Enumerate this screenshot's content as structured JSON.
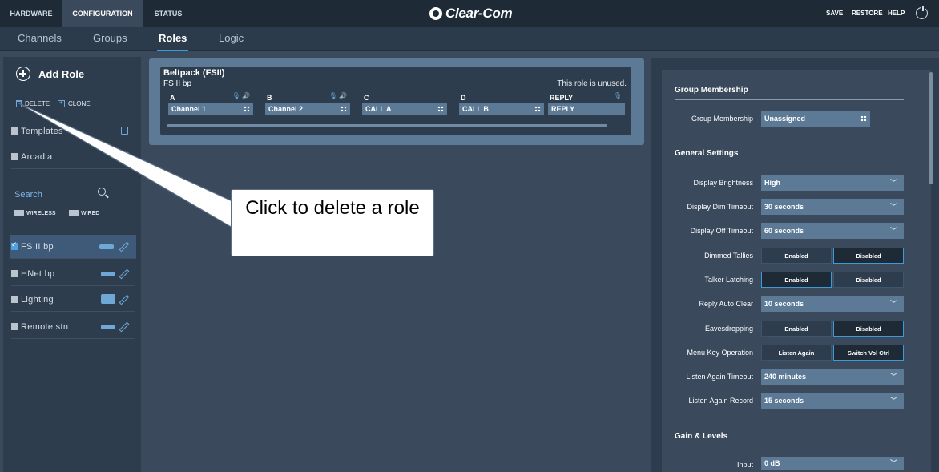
{
  "topbar": {
    "tabs": [
      "HARDWARE",
      "CONFIGURATION",
      "STATUS"
    ],
    "logo": "Clear-Com",
    "links": [
      "SAVE",
      "RESTORE",
      "HELP"
    ]
  },
  "subtabs": [
    "Channels",
    "Groups",
    "Roles",
    "Logic"
  ],
  "sidebar": {
    "add_role": "Add Role",
    "delete": "DELETE",
    "clone": "CLONE",
    "groups": [
      "Templates",
      "Arcadia"
    ],
    "search_placeholder": "Search",
    "filters": [
      "WIRELESS",
      "WIRED"
    ],
    "roles": [
      "FS II bp",
      "HNet bp",
      "Lighting",
      "Remote stn"
    ]
  },
  "role_card": {
    "title": "Beltpack (FSII)",
    "name": "FS II bp",
    "status": "This role is unused.",
    "keys": [
      {
        "letter": "A",
        "value": "Channel 1"
      },
      {
        "letter": "B",
        "value": "Channel 2"
      },
      {
        "letter": "C",
        "value": "CALL A"
      },
      {
        "letter": "D",
        "value": "CALL B"
      },
      {
        "letter": "REPLY",
        "value": "REPLY"
      }
    ]
  },
  "settings": {
    "group_membership_title": "Group Membership",
    "group_membership_label": "Group Membership",
    "group_membership_value": "Unassigned",
    "general_title": "General Settings",
    "display_brightness": {
      "label": "Display Brightness",
      "value": "High"
    },
    "display_dim_timeout": {
      "label": "Display Dim Timeout",
      "value": "30 seconds"
    },
    "display_off_timeout": {
      "label": "Display Off Timeout",
      "value": "60 seconds"
    },
    "dimmed_tallies": {
      "label": "Dimmed Tallies",
      "opt1": "Enabled",
      "opt2": "Disabled"
    },
    "talker_latching": {
      "label": "Talker Latching",
      "opt1": "Enabled",
      "opt2": "Disabled"
    },
    "reply_auto_clear": {
      "label": "Reply Auto Clear",
      "value": "10 seconds"
    },
    "eavesdropping": {
      "label": "Eavesdropping",
      "opt1": "Enabled",
      "opt2": "Disabled"
    },
    "menu_key_operation": {
      "label": "Menu Key Operation",
      "opt1": "Listen Again",
      "opt2": "Switch Vol Ctrl"
    },
    "listen_again_timeout": {
      "label": "Listen Again Timeout",
      "value": "240 minutes"
    },
    "listen_again_record": {
      "label": "Listen Again Record",
      "value": "15 seconds"
    },
    "gain_title": "Gain & Levels",
    "input": {
      "label": "Input",
      "value": "0 dB"
    }
  },
  "callout": {
    "text": "Click to delete a role"
  },
  "colors": {
    "accent": "#3d9bd9",
    "panel": "#2e3d4d",
    "field": "#5c7a96"
  }
}
